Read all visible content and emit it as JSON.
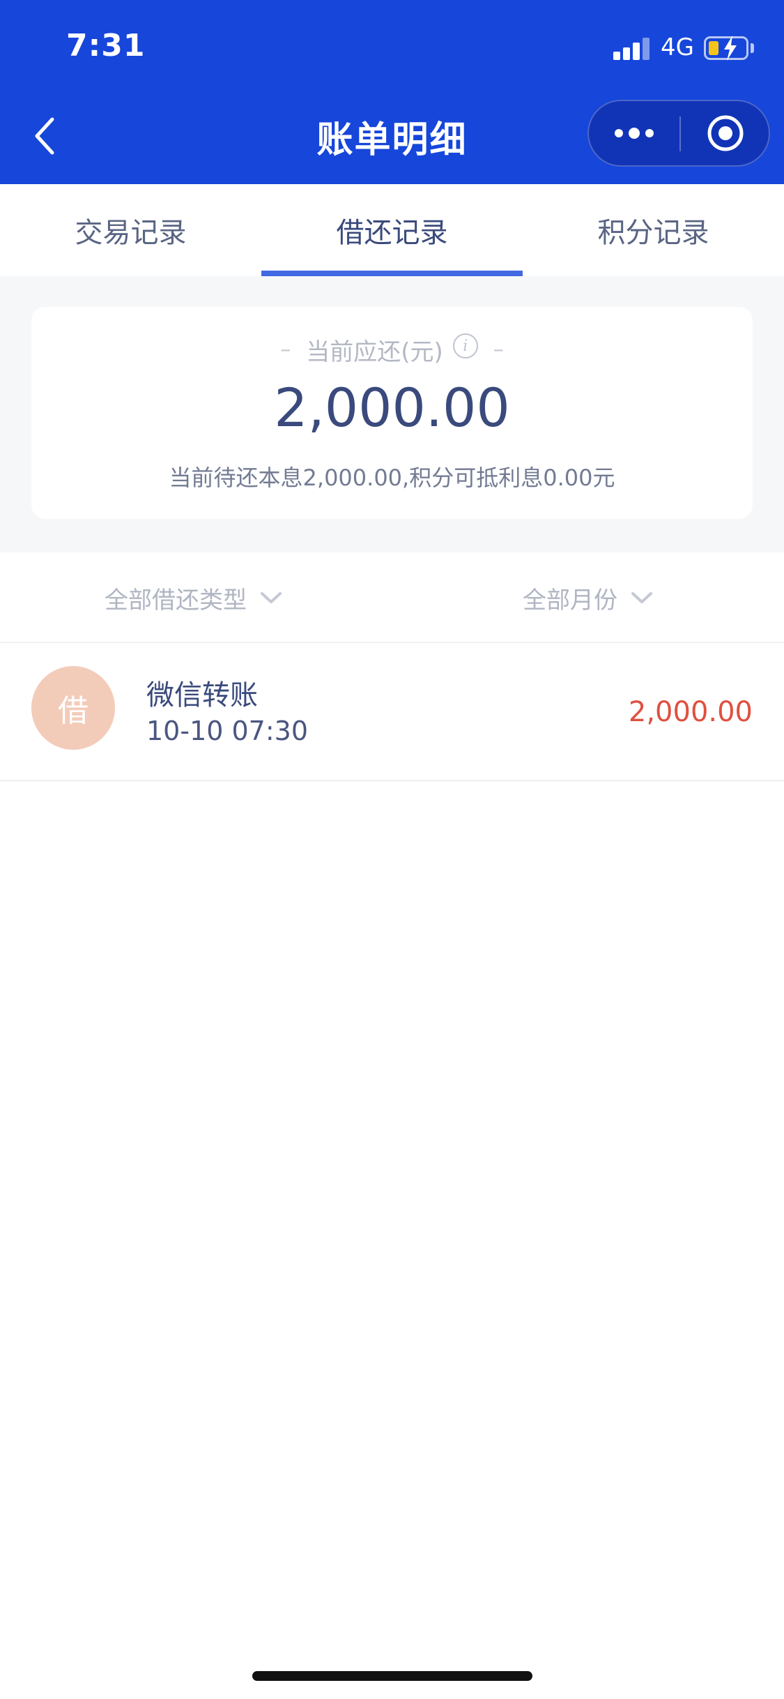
{
  "status_bar": {
    "time": "7:31",
    "network": "4G",
    "battery_icon": "battery-charging-icon",
    "battery_level_percent": 20,
    "signal_bars": 3
  },
  "nav": {
    "title": "账单明细",
    "back_icon": "chevron-left-icon",
    "more_icon": "more-dots-icon",
    "close_icon": "target-circle-icon"
  },
  "tabs": [
    {
      "label": "交易记录",
      "active": false
    },
    {
      "label": "借还记录",
      "active": true
    },
    {
      "label": "积分记录",
      "active": false
    }
  ],
  "summary": {
    "label": "当前应还(元)",
    "info_icon": "info-icon",
    "amount": "2,000.00",
    "description": "当前待还本息2,000.00,积分可抵利息0.00元"
  },
  "filters": {
    "type_label": "全部借还类型",
    "month_label": "全部月份",
    "chevron_icon": "chevron-down-icon"
  },
  "transactions": [
    {
      "badge": "借",
      "title": "微信转账",
      "time": "10-10 07:30",
      "amount": "2,000.00"
    }
  ],
  "colors": {
    "header_bg": "#1646da",
    "tab_indicator": "#4169e1",
    "amount_red": "#df5040",
    "badge_bg": "#f3cbb9",
    "primary_text": "#3a4a7c"
  }
}
